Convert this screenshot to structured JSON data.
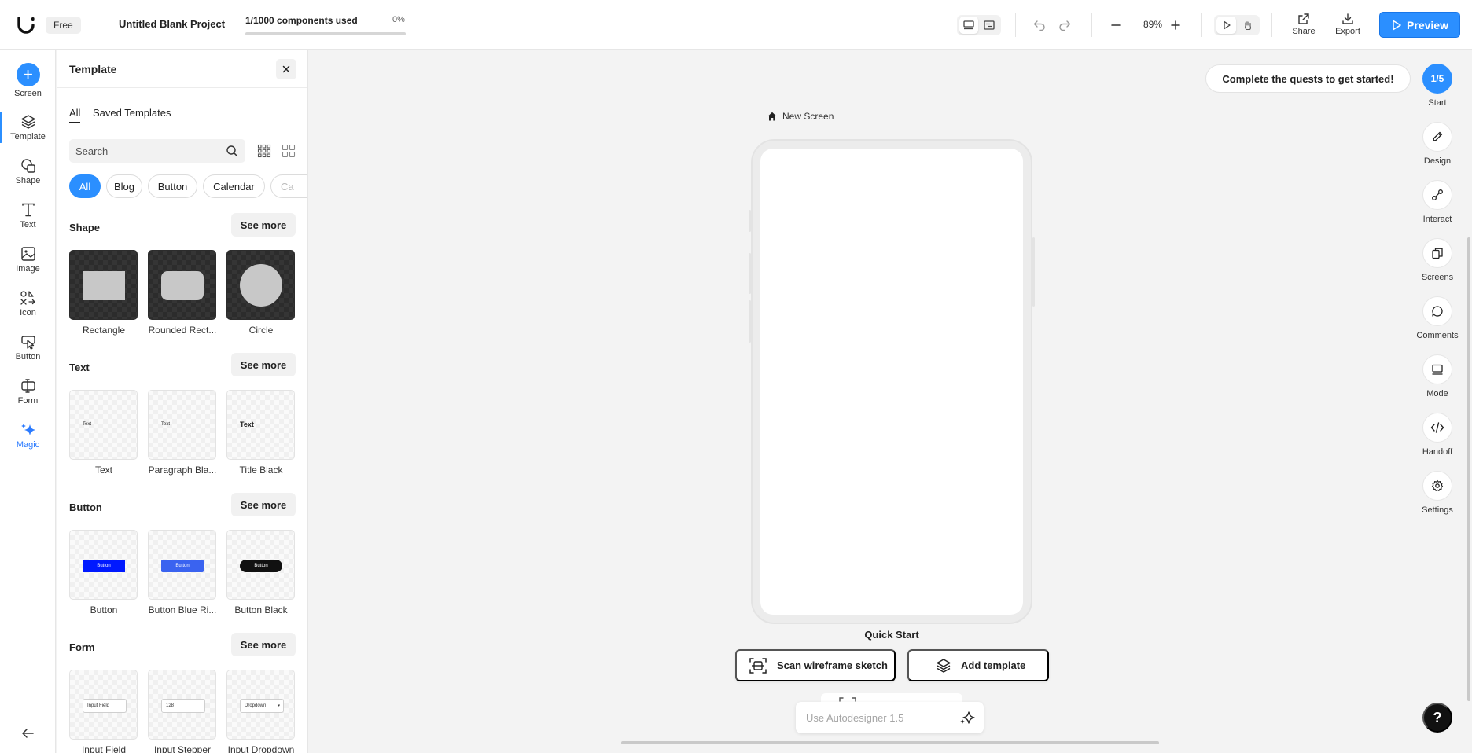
{
  "topbar": {
    "plan": "Free",
    "project_title": "Untitled Blank Project",
    "usage_label": "1/1000 components used",
    "usage_percent_label": "0%",
    "usage_fraction": 0.0,
    "zoom": "89%",
    "share_label": "Share",
    "export_label": "Export",
    "preview_label": "Preview"
  },
  "left_rail": {
    "items": [
      {
        "label": "Screen",
        "icon": "plus-icon"
      },
      {
        "label": "Template",
        "icon": "layers-icon"
      },
      {
        "label": "Shape",
        "icon": "shape-icon"
      },
      {
        "label": "Text",
        "icon": "text-icon"
      },
      {
        "label": "Image",
        "icon": "image-icon"
      },
      {
        "label": "Icon",
        "icon": "icon-set-icon"
      },
      {
        "label": "Button",
        "icon": "cursor-click-icon"
      },
      {
        "label": "Form",
        "icon": "form-icon"
      },
      {
        "label": "Magic",
        "icon": "sparkle-icon"
      }
    ],
    "active": "Template"
  },
  "panel": {
    "title": "Template",
    "tabs": [
      "All",
      "Saved Templates"
    ],
    "search_placeholder": "Search",
    "chips": [
      "All",
      "Blog",
      "Button",
      "Calendar",
      "Ca"
    ],
    "see_more": "See more",
    "sections": [
      {
        "title": "Shape",
        "cards": [
          "Rectangle",
          "Rounded Rect...",
          "Circle"
        ]
      },
      {
        "title": "Text",
        "cards": [
          "Text",
          "Paragraph Bla...",
          "Title Black"
        ],
        "thumbs": [
          "Text",
          "Text",
          "Text"
        ]
      },
      {
        "title": "Button",
        "cards": [
          "Button",
          "Button Blue Ri...",
          "Button Black"
        ],
        "thumbs": [
          "Button",
          "Button",
          "Button"
        ]
      },
      {
        "title": "Form",
        "cards": [
          "Input Field",
          "Input Stepper",
          "Input Dropdown"
        ],
        "thumbs": [
          "Input Field",
          "128",
          "Dropdown"
        ]
      }
    ],
    "colors": {
      "btn_blue": "#0019ff",
      "btn_blue_light": "#3a63f0",
      "btn_black": "#111111"
    }
  },
  "canvas": {
    "screen_name": "New Screen",
    "quick_start": "Quick Start",
    "scan_label": "Scan wireframe sketch",
    "add_template_label": "Add template",
    "ai_placeholder": "Use Autodesigner 1.5",
    "quest_text": "Complete the quests to get started!"
  },
  "right_rail": {
    "progress": "1/5",
    "start_label": "Start",
    "items": [
      {
        "label": "Design",
        "icon": "pencil-icon"
      },
      {
        "label": "Interact",
        "icon": "link-nodes-icon"
      },
      {
        "label": "Screens",
        "icon": "screens-icon"
      },
      {
        "label": "Comments",
        "icon": "comment-icon"
      },
      {
        "label": "Mode",
        "icon": "monitor-icon"
      },
      {
        "label": "Handoff",
        "icon": "code-icon"
      },
      {
        "label": "Settings",
        "icon": "gear-icon"
      }
    ],
    "help": "?"
  },
  "accent": "#2b8fff"
}
